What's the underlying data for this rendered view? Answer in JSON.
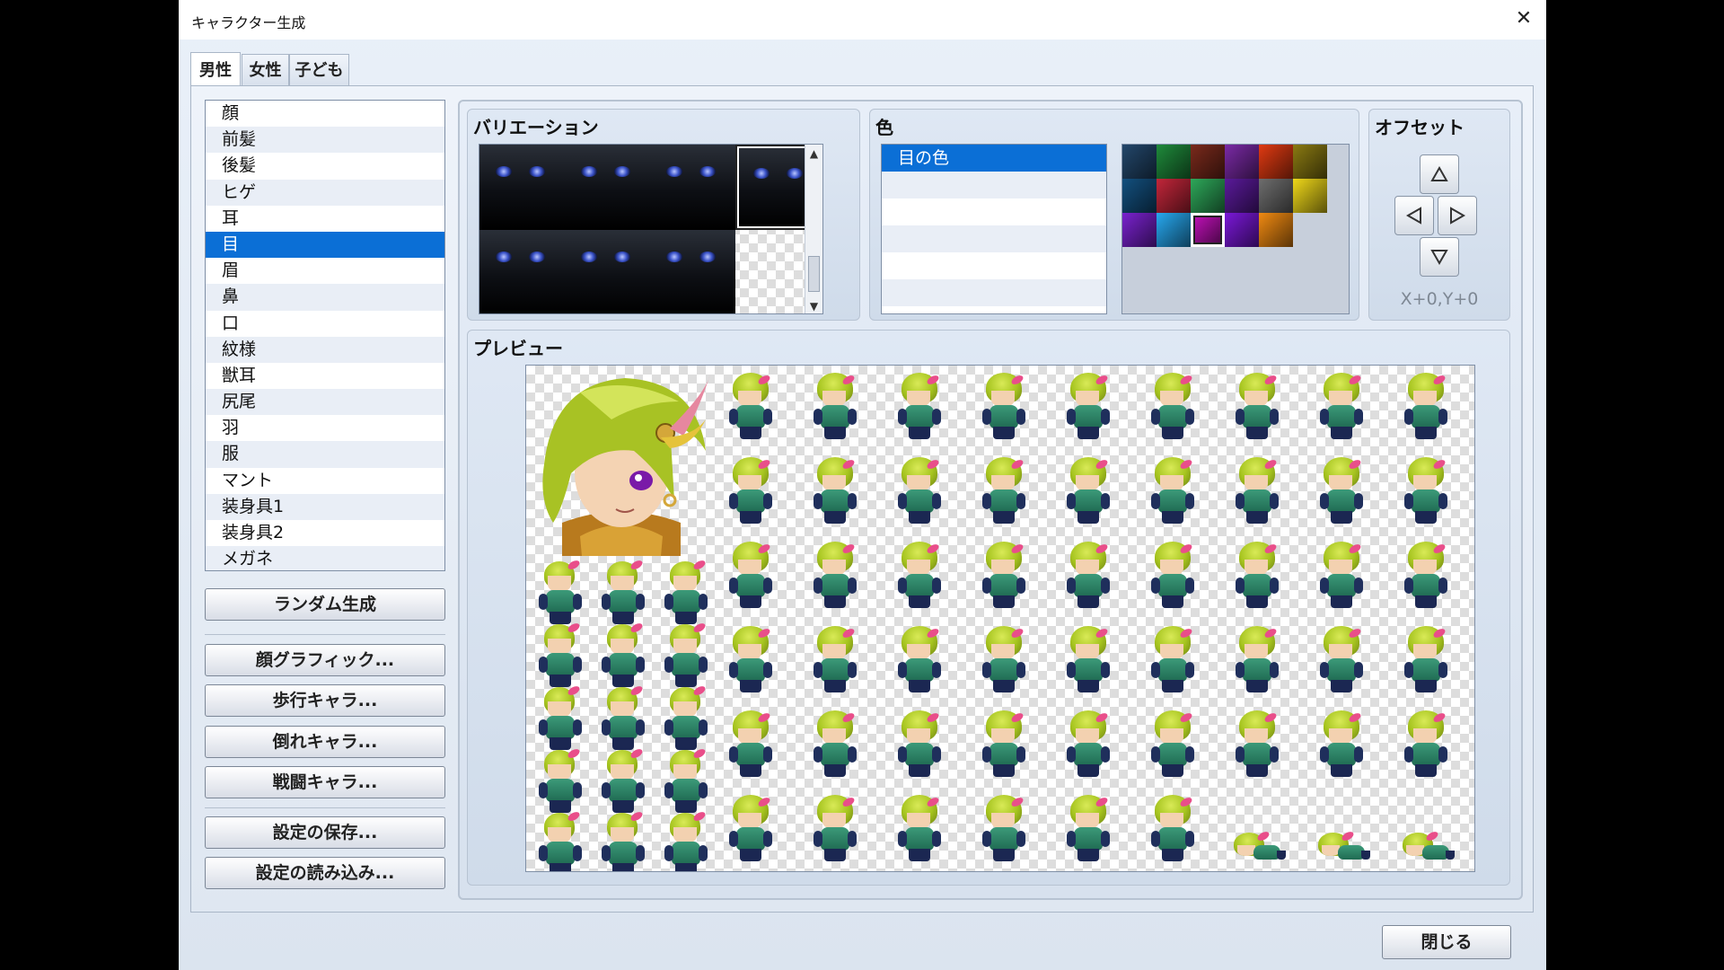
{
  "window": {
    "title": "キャラクター生成",
    "close_glyph": "✕"
  },
  "tabs": [
    {
      "label": "男性",
      "active": true
    },
    {
      "label": "女性",
      "active": false
    },
    {
      "label": "子ども",
      "active": false
    }
  ],
  "parts": {
    "items": [
      "顔",
      "前髪",
      "後髪",
      "ヒゲ",
      "耳",
      "目",
      "眉",
      "鼻",
      "口",
      "紋様",
      "獣耳",
      "尻尾",
      "羽",
      "服",
      "マント",
      "装身具1",
      "装身具2",
      "メガネ"
    ],
    "selected_index": 5
  },
  "buttons": {
    "random": "ランダム生成",
    "face_graphic": "顔グラフィック...",
    "walk_chara": "歩行キャラ...",
    "down_chara": "倒れキャラ...",
    "battle_chara": "戦闘キャラ...",
    "save_settings": "設定の保存...",
    "load_settings": "設定の読み込み...",
    "close": "閉じる"
  },
  "variation": {
    "title": "バリエーション",
    "count": 7,
    "selected_index": 3
  },
  "color": {
    "title": "色",
    "items": [
      "目の色"
    ],
    "selected_index": 0,
    "palette": [
      "#23476b",
      "#1f8a3b",
      "#7a2a1c",
      "#7a2aa5",
      "#e03a12",
      "#8a7a12",
      "#13507f",
      "#c2263a",
      "#2ea85a",
      "#5a1a9a",
      "#6e6e6e",
      "#efd81a",
      "#7a22cf",
      "#27a8f0",
      "#c011b8",
      "#7a18d8",
      "#f08a12"
    ],
    "selected_swatch": 14
  },
  "offset": {
    "title": "オフセット",
    "value": "X+0,Y+0"
  },
  "preview": {
    "title": "プレビュー"
  }
}
